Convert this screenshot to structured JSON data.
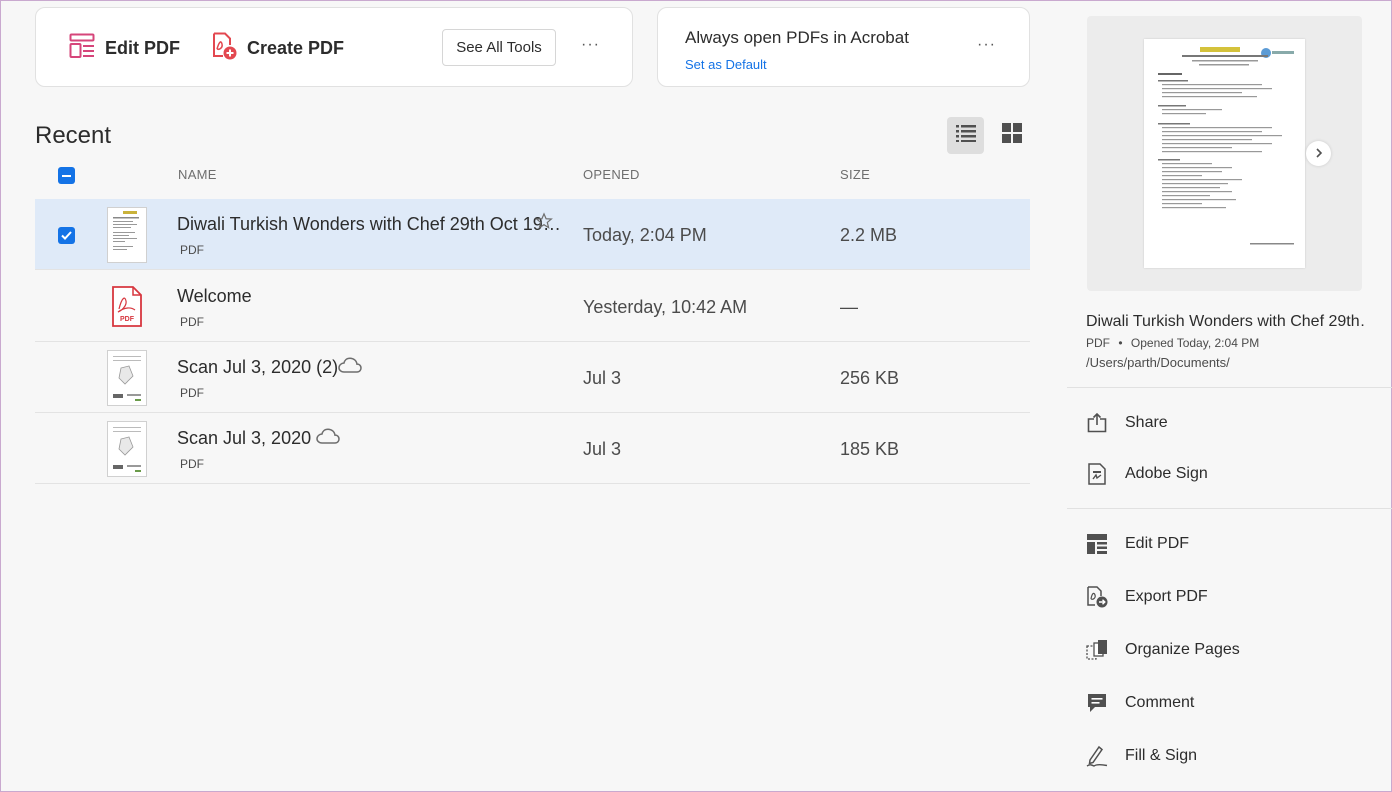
{
  "tools_card": {
    "edit_pdf": "Edit PDF",
    "create_pdf": "Create PDF",
    "see_all_tools": "See All Tools",
    "more": "···"
  },
  "default_card": {
    "title": "Always open PDFs in Acrobat",
    "link": "Set as Default",
    "more": "···"
  },
  "recent": {
    "title": "Recent",
    "columns": {
      "name": "NAME",
      "opened": "OPENED",
      "size": "SIZE"
    },
    "rows": [
      {
        "name": "Diwali Turkish Wonders with Chef 29th Oct 19…",
        "type": "PDF",
        "opened": "Today, 2:04 PM",
        "size": "2.2 MB",
        "selected": true,
        "starred_icon": "star-outline-icon"
      },
      {
        "name": "Welcome",
        "type": "PDF",
        "opened": "Yesterday, 10:42 AM",
        "size": "—",
        "selected": false
      },
      {
        "name": "Scan Jul 3, 2020 (2)",
        "type": "PDF",
        "opened": "Jul 3",
        "size": "256 KB",
        "selected": false,
        "cloud_icon": "cloud-icon"
      },
      {
        "name": "Scan Jul 3, 2020",
        "type": "PDF",
        "opened": "Jul 3",
        "size": "185 KB",
        "selected": false,
        "cloud_icon": "cloud-icon"
      }
    ]
  },
  "details": {
    "name": "Diwali Turkish Wonders with Chef 29th…",
    "type": "PDF",
    "bullet": "•",
    "opened": "Opened Today, 2:04 PM",
    "path": "/Users/parth/Documents/",
    "actions": [
      {
        "label": "Share",
        "icon": "share-icon"
      },
      {
        "label": "Adobe Sign",
        "icon": "adobe-sign-icon"
      },
      {
        "label": "Edit PDF",
        "icon": "edit-pdf-icon"
      },
      {
        "label": "Export PDF",
        "icon": "export-pdf-icon"
      },
      {
        "label": "Organize Pages",
        "icon": "organize-pages-icon"
      },
      {
        "label": "Comment",
        "icon": "comment-icon"
      },
      {
        "label": "Fill & Sign",
        "icon": "fill-sign-icon"
      }
    ]
  },
  "colors": {
    "accent": "#1473e6",
    "selected_row": "#dfeaf8",
    "edit_icon": "#d6457a",
    "create_icon": "#e34850",
    "pdf_red": "#d7373f"
  }
}
